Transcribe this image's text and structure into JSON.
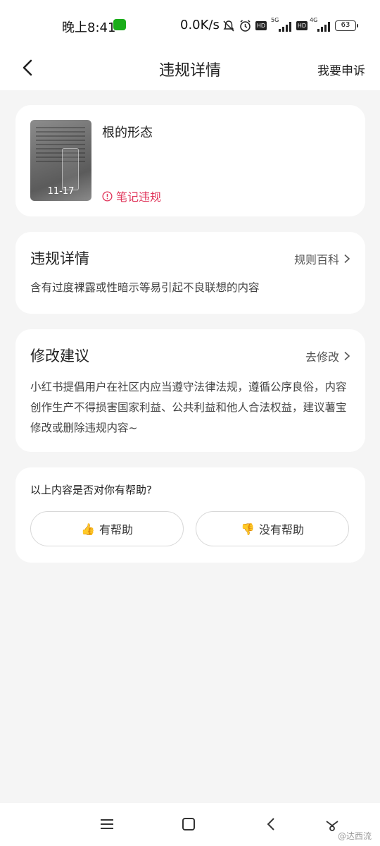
{
  "status_bar": {
    "time": "晚上8:41",
    "speed": "0.0K/s",
    "network_1": "5G",
    "network_2": "4G",
    "hd": "HD",
    "battery": "63"
  },
  "nav": {
    "title": "违规详情",
    "appeal_label": "我要申诉"
  },
  "note": {
    "title": "根的形态",
    "thumbnail_date": "11-17",
    "violation_label": "笔记违规"
  },
  "detail": {
    "title": "违规详情",
    "link_label": "规则百科",
    "text": "含有过度裸露或性暗示等易引起不良联想的内容"
  },
  "suggestion": {
    "title": "修改建议",
    "link_label": "去修改",
    "text": "小红书提倡用户在社区内应当遵守法律法规，遵循公序良俗，内容创作生产不得损害国家利益、公共利益和他人合法权益，建议薯宝修改或删除违规内容~"
  },
  "feedback": {
    "question": "以上内容是否对你有帮助?",
    "yes_label": "有帮助",
    "no_label": "没有帮助",
    "yes_icon": "👍",
    "no_icon": "👎"
  },
  "watermark": "@达西流",
  "colors": {
    "accent_red": "#e0345a",
    "background": "#f5f5f5",
    "card": "#ffffff"
  }
}
